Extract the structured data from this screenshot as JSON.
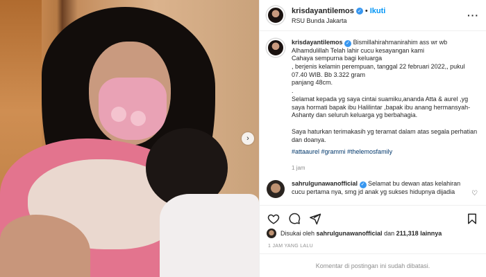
{
  "post": {
    "next_icon": "chevron-right-icon"
  },
  "header": {
    "username": "krisdayantilemos",
    "separator": "•",
    "follow_label": "Ikuti",
    "location": "RSU Bunda Jakarta",
    "more_label": "···"
  },
  "caption": {
    "username": "krisdayantilemos",
    "lines": [
      "Bismillahirahmanirahim ass wr wb",
      "Alhamdulillah Telah lahir cucu kesayangan kami",
      "Cahaya sempurna bagi keluarga",
      ", berjenis kelamin perempuan, tanggal 22 februari 2022,, pukul",
      "07.40 WIB. Bb 3.322 gram",
      "panjang 48cm.",
      ".",
      "Selamat kepada yg saya cintai suamiku,ananda Atta & aurel ,yg",
      "saya hormati bapak ibu Halilintar ,bapak ibu anang hermansyah-",
      "Ashanty dan seluruh keluarga yg berbahagia.",
      "Saya haturkan terimakasih yg teramat dalam atas segala perhatian",
      "dan doanya."
    ],
    "hashtags": "#attaaurel #grammi #thelemosfamily",
    "time": "1 jam"
  },
  "comment": {
    "username": "sahrulgunawanofficial",
    "text": "Selamat bu dewan atas kelahiran",
    "text2": "cucu pertama nya, smg jd anak yg sukses hidupnya dijadia"
  },
  "likes": {
    "prefix": "Disukai oleh",
    "user": "sahrulgunawanofficial",
    "middle": "dan",
    "count": "211,318",
    "suffix": "lainnya"
  },
  "time_ago": "1 JAM YANG LALU",
  "comments_limited": "Komentar di postingan ini sudah dibatasi."
}
